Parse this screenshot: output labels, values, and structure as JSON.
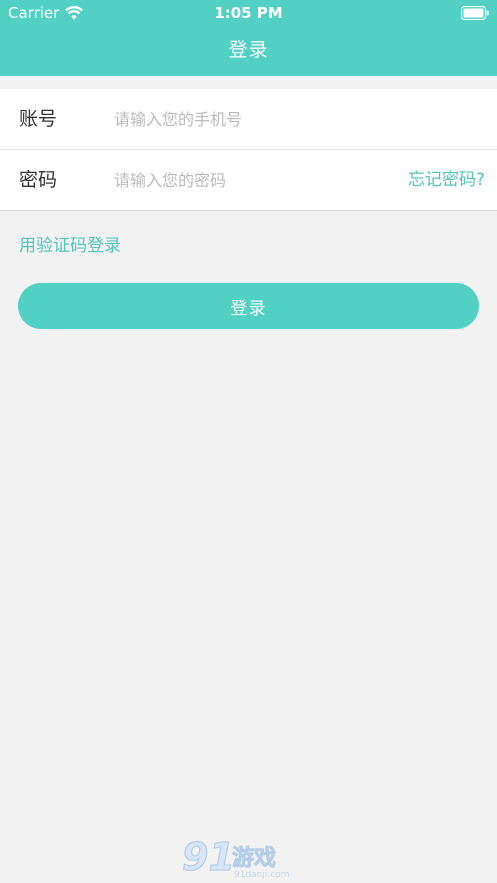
{
  "status_bar": {
    "carrier": "Carrier",
    "time": "1:05 PM",
    "icons": [
      "wifi-icon",
      "battery-icon"
    ]
  },
  "nav": {
    "title": "登录"
  },
  "form": {
    "account": {
      "label": "账号",
      "placeholder": "请输入您的手机号",
      "value": ""
    },
    "password": {
      "label": "密码",
      "placeholder": "请输入您的密码",
      "value": "",
      "forgot_label": "忘记密码?"
    }
  },
  "sms_login_label": "用验证码登录",
  "login_button_label": "登录",
  "watermark": {
    "logo_text": "91游戏",
    "site_text": "91danji.com"
  },
  "colors": {
    "accent": "#52d0c4",
    "link": "#52c6bb",
    "background": "#f2f2f2",
    "surface": "#ffffff",
    "label_text": "#333333",
    "placeholder_text": "#bbbbbb"
  }
}
